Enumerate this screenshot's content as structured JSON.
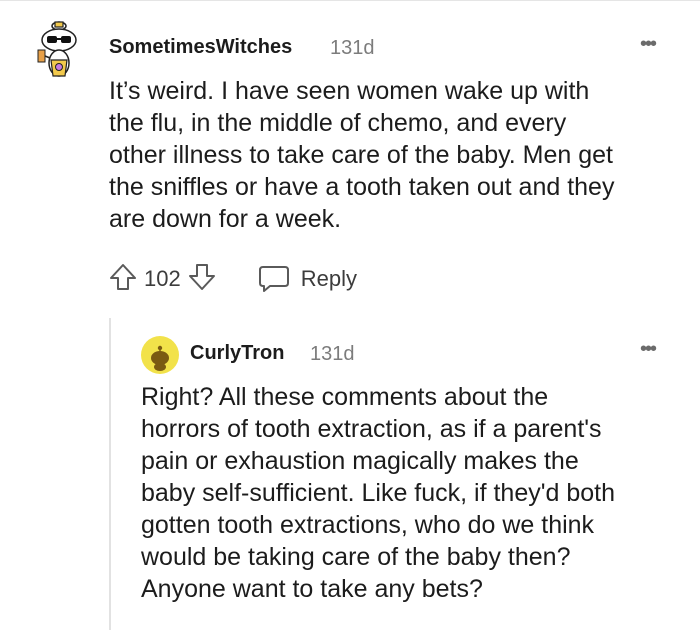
{
  "comment": {
    "username": "SometimesWitches",
    "age": "131d",
    "more": "•••",
    "lines": [
      "It’s weird. I have seen women wake up with",
      "the flu, in the middle of chemo, and every",
      "other illness to take care of the baby. Men get",
      "the sniffles or have a tooth taken out and they",
      "are down for a week."
    ],
    "votes": "102",
    "reply_label": "Reply"
  },
  "reply": {
    "username": "CurlyTron",
    "age": "131d",
    "more": "•••",
    "lines": [
      "Right? All these comments about the",
      "horrors of tooth extraction, as if a parent's",
      "pain or exhaustion magically makes the",
      "baby self-sufficient. Like fuck, if they'd both",
      "gotten tooth extractions, who do we think",
      "would be taking care of the baby then?",
      "Anyone want to take any bets?"
    ]
  },
  "icons": {
    "upvote": "arrow-up-outline",
    "downvote": "arrow-down-outline",
    "reply": "speech-bubble-outline",
    "more": "horizontal-ellipsis"
  }
}
